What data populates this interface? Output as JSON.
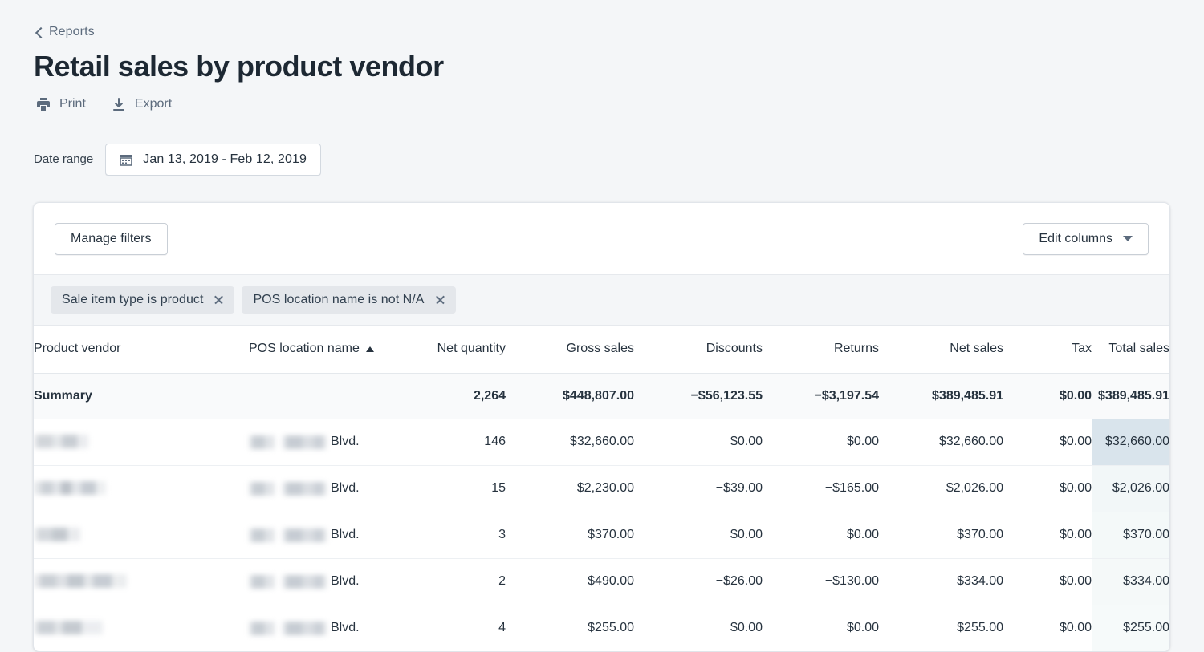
{
  "breadcrumb": {
    "label": "Reports",
    "icon": "chevron-left-icon"
  },
  "header": {
    "title": "Retail sales by product vendor"
  },
  "actions": [
    {
      "label": "Print",
      "icon": "printer-icon"
    },
    {
      "label": "Export",
      "icon": "download-icon"
    }
  ],
  "date_range": {
    "label": "Date range",
    "value": "Jan 13, 2019 - Feb 12, 2019",
    "icon": "calendar-icon"
  },
  "toolbar": {
    "manage_filters_label": "Manage filters",
    "edit_columns_label": "Edit columns",
    "edit_columns_icon": "chevron-down-icon"
  },
  "filters": [
    {
      "label": "Sale item type is product",
      "remove_icon": "close-icon"
    },
    {
      "label": "POS location name is not N/A",
      "remove_icon": "close-icon"
    }
  ],
  "table": {
    "columns": [
      {
        "key": "vendor",
        "label": "Product vendor",
        "align": "left"
      },
      {
        "key": "pos",
        "label": "POS location name",
        "align": "left",
        "sorted": "asc",
        "sort_icon": "caret-up-icon"
      },
      {
        "key": "net_qty",
        "label": "Net quantity",
        "align": "right"
      },
      {
        "key": "gross",
        "label": "Gross sales",
        "align": "right"
      },
      {
        "key": "discounts",
        "label": "Discounts",
        "align": "right"
      },
      {
        "key": "returns",
        "label": "Returns",
        "align": "right"
      },
      {
        "key": "net_sales",
        "label": "Net sales",
        "align": "right"
      },
      {
        "key": "tax",
        "label": "Tax",
        "align": "right"
      },
      {
        "key": "total",
        "label": "Total sales",
        "align": "right"
      }
    ],
    "summary": {
      "label": "Summary",
      "pos": "",
      "net_qty": "2,264",
      "gross": "$448,807.00",
      "discounts": "−$56,123.55",
      "returns": "−$3,197.54",
      "net_sales": "$389,485.91",
      "tax": "$0.00",
      "total": "$389,485.91"
    },
    "rows": [
      {
        "vendor": "",
        "vendor_redacted": true,
        "pos_suffix": "Blvd.",
        "pos_redacted": true,
        "net_qty": "146",
        "gross": "$32,660.00",
        "discounts": "$0.00",
        "returns": "$0.00",
        "net_sales": "$32,660.00",
        "tax": "$0.00",
        "total": "$32,660.00"
      },
      {
        "vendor": "",
        "vendor_redacted": true,
        "pos_suffix": "Blvd.",
        "pos_redacted": true,
        "net_qty": "15",
        "gross": "$2,230.00",
        "discounts": "−$39.00",
        "returns": "−$165.00",
        "net_sales": "$2,026.00",
        "tax": "$0.00",
        "total": "$2,026.00"
      },
      {
        "vendor": "",
        "vendor_redacted": true,
        "pos_suffix": "Blvd.",
        "pos_redacted": true,
        "net_qty": "3",
        "gross": "$370.00",
        "discounts": "$0.00",
        "returns": "$0.00",
        "net_sales": "$370.00",
        "tax": "$0.00",
        "total": "$370.00"
      },
      {
        "vendor": "",
        "vendor_redacted": true,
        "pos_suffix": "Blvd.",
        "pos_redacted": true,
        "net_qty": "2",
        "gross": "$490.00",
        "discounts": "−$26.00",
        "returns": "−$130.00",
        "net_sales": "$334.00",
        "tax": "$0.00",
        "total": "$334.00"
      },
      {
        "vendor": "",
        "vendor_redacted": true,
        "pos_suffix": "Blvd.",
        "pos_redacted": true,
        "net_qty": "4",
        "gross": "$255.00",
        "discounts": "$0.00",
        "returns": "$0.00",
        "net_sales": "$255.00",
        "tax": "$0.00",
        "total": "$255.00"
      }
    ]
  },
  "colors": {
    "page_background": "#f4f6f8",
    "card_background": "#ffffff",
    "text_primary": "#27333f",
    "text_secondary": "#5c6b7d",
    "chip_background": "#e4e7eb",
    "highlight_column_strong": "#d9e4ec",
    "highlight_column_faint": "#f4f9f9"
  }
}
